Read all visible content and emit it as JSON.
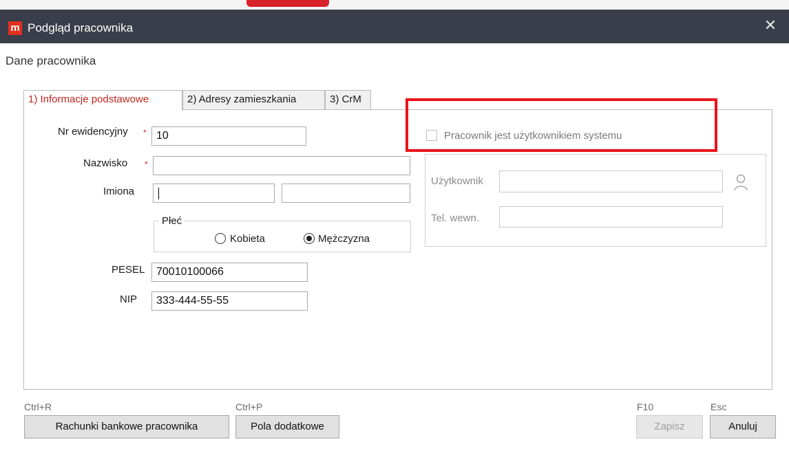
{
  "window": {
    "title": "Podgląd pracownika",
    "logo": "m",
    "close_symbol": "✕"
  },
  "section_title": "Dane pracownika",
  "tabs": [
    {
      "label": "1) Informacje podstawowe",
      "active": true
    },
    {
      "label": "2) Adresy zamieszkania",
      "active": false
    },
    {
      "label": "3) CrM",
      "active": false
    }
  ],
  "form": {
    "nr_label": "Nr ewidencyjny",
    "nr_value": "10",
    "nazwisko_label": "Nazwisko",
    "nazwisko_value": "",
    "imiona_label": "Imiona",
    "imie1_value": "",
    "imie2_value": "",
    "plec_label": "Płeć",
    "kobieta_label": "Kobieta",
    "mezczyzna_label": "Mężczyzna",
    "selected_gender": "Mężczyzna",
    "pesel_label": "PESEL",
    "pesel_value": "70010100066",
    "nip_label": "NIP",
    "nip_value": "333-444-55-55",
    "required_mark": "*"
  },
  "system_user": {
    "checkbox_label": "Pracownik jest użytkownikiem systemu",
    "checked": false,
    "uzytkownik_label": "Użytkownik",
    "tel_label": "Tel. wewn.",
    "uzytkownik_value": "",
    "tel_value": "",
    "user_icon": "user-icon"
  },
  "buttons": {
    "rachunki_shortcut": "Ctrl+R",
    "rachunki_label": "Rachunki bankowe pracownika",
    "pola_shortcut": "Ctrl+P",
    "pola_label": "Pola dodatkowe",
    "zapisz_shortcut": "F10",
    "zapisz_label": "Zapisz",
    "anuluj_shortcut": "Esc",
    "anuluj_label": "Anuluj"
  },
  "colors": {
    "titlebar": "#393e4a",
    "accent_red": "#d9212b",
    "highlight_frame": "#e8141b"
  }
}
